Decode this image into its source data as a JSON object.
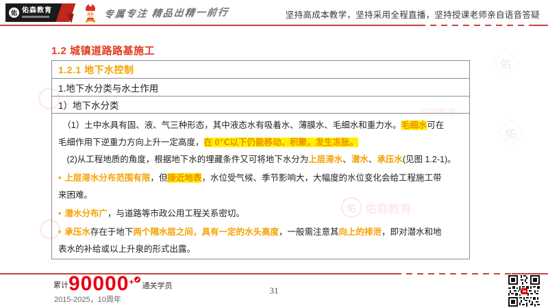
{
  "header": {
    "logo": {
      "mark": "佑",
      "brand": "佑森教育"
    },
    "slogan": "专属专注 精品出精一前行",
    "right_text": "坚持高成本教学，坚持采用全程直播，坚持授课老师亲自语音答疑"
  },
  "content": {
    "section_title": "1.2 城镇道路路基施工",
    "table": {
      "row1": "1.2.1 地下水控制",
      "row2": "1.地下水分类与水土作用",
      "row3": "1）地下水分类"
    },
    "paragraphs": [
      {
        "bullet": false,
        "segs": [
          {
            "t": "　（1）土中水具有固、液、气三种形态，其中液态水有吸着水、薄膜水、毛细水和重力水。",
            "s": "n"
          },
          {
            "t": "毛细水",
            "s": "h"
          },
          {
            "t": "可在\n毛细作用下逆重力方向上升一定高度，",
            "s": "n"
          },
          {
            "t": "在 0℃以下仍能移动、积聚，发生冻胀。",
            "s": "h"
          }
        ]
      },
      {
        "bullet": false,
        "segs": [
          {
            "t": "　(2)从工程地质的角度，根据地下水的埋藏条件又可将地下水分为",
            "s": "n"
          },
          {
            "t": "上层滞水",
            "s": "o"
          },
          {
            "t": "、",
            "s": "n"
          },
          {
            "t": "潜水",
            "s": "o"
          },
          {
            "t": "、",
            "s": "n"
          },
          {
            "t": "承压水",
            "s": "o"
          },
          {
            "t": "(见图 1.2-1)。",
            "s": "n"
          }
        ]
      },
      {
        "bullet": true,
        "segs": [
          {
            "t": "上层滞水分布范围有限",
            "s": "o"
          },
          {
            "t": "，但",
            "s": "n"
          },
          {
            "t": "接近地表",
            "s": "h"
          },
          {
            "t": "，水位受气候、季节影响大，大幅度的水位变化会给工程施工带\n来困难。",
            "s": "n"
          }
        ]
      },
      {
        "bullet": true,
        "segs": [
          {
            "t": "潜水分布广",
            "s": "o"
          },
          {
            "t": "，与道路等市政公用工程关系密切。",
            "s": "n"
          }
        ]
      },
      {
        "bullet": true,
        "segs": [
          {
            "t": "承压水",
            "s": "o"
          },
          {
            "t": "存在于地下",
            "s": "n"
          },
          {
            "t": "两个隔水层之间",
            "s": "o"
          },
          {
            "t": "，",
            "s": "o"
          },
          {
            "t": "具有一定的水头高度",
            "s": "o"
          },
          {
            "t": "，一般需注意其",
            "s": "n"
          },
          {
            "t": "向上的排泄",
            "s": "o"
          },
          {
            "t": "，即对潜水和地\n表水的补给或以上升泉的形式出露。",
            "s": "n"
          }
        ]
      }
    ]
  },
  "watermarks": {
    "brand": "佑森教育",
    "mark": "佑"
  },
  "footer": {
    "prefix": "累计",
    "count": "90000",
    "plus": "+",
    "suffix": "通关学员",
    "years": "2015-2025，10周年",
    "page_number": "31"
  },
  "colors": {
    "brand_red": "#c4433d",
    "title_red": "#e23a1d",
    "orange": "#f5a100",
    "highlight": "#fff100",
    "number_red": "#e60012"
  }
}
